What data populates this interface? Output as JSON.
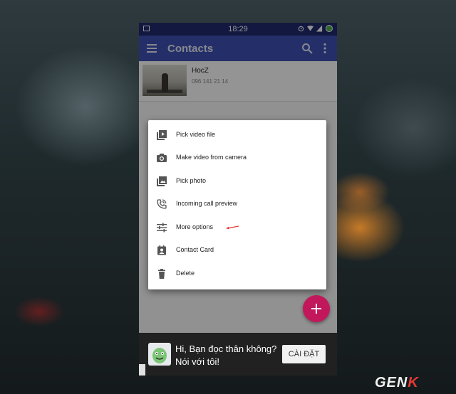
{
  "status_bar": {
    "time": "18:29",
    "battery_color": "#4caf50"
  },
  "app_bar": {
    "title": "Contacts",
    "color": "#3f51b5",
    "icons": [
      "menu-icon",
      "search-icon",
      "more-vert-icon"
    ]
  },
  "contacts": [
    {
      "name": "HocZ",
      "phone": "096 141 21 14"
    }
  ],
  "context_menu": {
    "items": [
      {
        "label": "Pick video file",
        "icon": "video-file-icon"
      },
      {
        "label": "Make video from camera",
        "icon": "camera-icon"
      },
      {
        "label": "Pick photo",
        "icon": "photo-icon"
      },
      {
        "label": "Incoming call preview",
        "icon": "phone-call-icon"
      },
      {
        "label": "More options",
        "icon": "tune-icon"
      },
      {
        "label": "Contact Card",
        "icon": "contact-card-icon"
      },
      {
        "label": "Delete",
        "icon": "delete-icon"
      }
    ],
    "annotation_color": "#e53935"
  },
  "fab": {
    "icon": "add-icon",
    "color": "#c2185b"
  },
  "ad_banner": {
    "text": "Hi, Bạn đọc thân không? Nói với tôi!",
    "button_label": "CÀI ĐẶT"
  },
  "watermark": {
    "text_main": "GEN",
    "text_accent": "K"
  }
}
